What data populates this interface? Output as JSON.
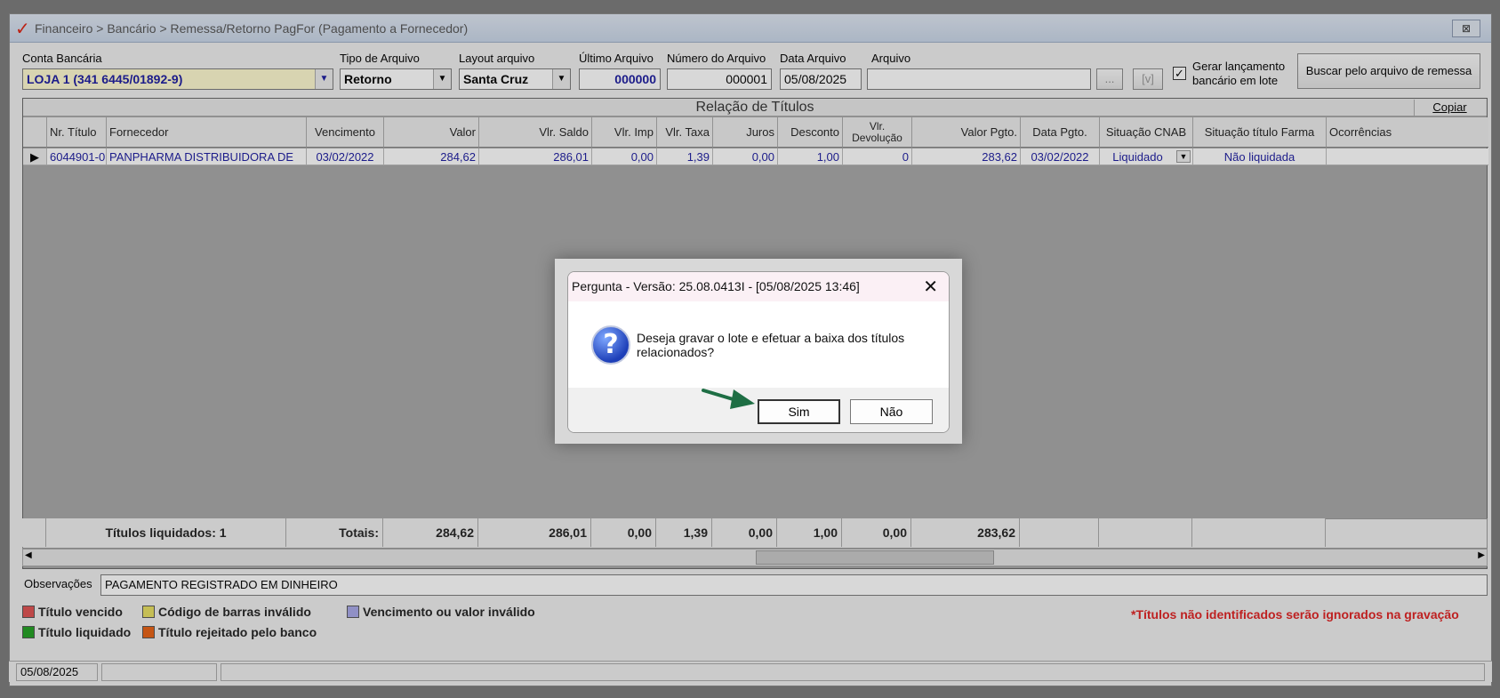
{
  "window": {
    "title": "Financeiro > Bancário > Remessa/Retorno PagFor (Pagamento  a Fornecedor)",
    "close_glyph": "⊠"
  },
  "form": {
    "conta_label": "Conta Bancária",
    "conta_value": "LOJA 1 (341 6445/01892-9)",
    "tipo_label": "Tipo de Arquivo",
    "tipo_value": "Retorno",
    "layout_label": "Layout arquivo",
    "layout_value": "Santa Cruz",
    "ultimo_label": "Último Arquivo",
    "ultimo_value": "000000",
    "numero_label": "Número do Arquivo",
    "numero_value": "000001",
    "data_label": "Data Arquivo",
    "data_value": "05/08/2025",
    "arquivo_label": "Arquivo",
    "arquivo_value": "",
    "browse_label": "...",
    "view_label": "[v]",
    "gerar_label_1": "Gerar lançamento",
    "gerar_label_2": "bancário em lote",
    "buscar_label": "Buscar pelo arquivo de remessa"
  },
  "grid": {
    "caption": "Relação de Títulos",
    "copy_label": "Copiar",
    "columns": [
      "Nr. Título",
      "Fornecedor",
      "Vencimento",
      "Valor",
      "Vlr. Saldo",
      "Vlr. Imp",
      "Vlr. Taxa",
      "Juros",
      "Desconto",
      "Vlr. Devolução",
      "Valor Pgto.",
      "Data Pgto.",
      "Situação CNAB",
      "Situação título Farma",
      "Ocorrências"
    ],
    "row": [
      "6044901-0",
      "PANPHARMA DISTRIBUIDORA DE",
      "03/02/2022",
      "284,62",
      "286,01",
      "0,00",
      "1,39",
      "0,00",
      "1,00",
      "0",
      "283,62",
      "03/02/2022",
      "Liquidado",
      "Não liquidada",
      ""
    ],
    "totals": {
      "liquidados": "Títulos liquidados: 1",
      "totais": "Totais:",
      "valor": "284,62",
      "saldo": "286,01",
      "imp": "0,00",
      "taxa": "1,39",
      "juros": "0,00",
      "desconto": "1,00",
      "devolucao": "0,00",
      "pgto": "283,62"
    }
  },
  "observacoes": {
    "label": "Observações",
    "value": "PAGAMENTO REGISTRADO EM DINHEIRO"
  },
  "legend": {
    "vencido": "Título vencido",
    "codigo": "Código de barras inválido",
    "venc_valor": "Vencimento ou valor inválido",
    "liquidado": "Título liquidado",
    "rejeitado": "Título rejeitado pelo banco",
    "warning": "*Títulos não identificados serão ignorados na gravação",
    "colors": {
      "vencido": "#e05050",
      "codigo": "#e8e060",
      "venc_valor": "#a8a8e8",
      "liquidado": "#20a020",
      "rejeitado": "#e86010",
      "warning": "#e02020"
    }
  },
  "statusbar": {
    "date": "05/08/2025"
  },
  "dialog": {
    "title": "Pergunta - Versão: 25.08.0413I - [05/08/2025 13:46]",
    "close_glyph": "✕",
    "message": "Deseja gravar o lote e efetuar a baixa dos títulos relacionados?",
    "icon": "question-icon",
    "icon_glyph": "?",
    "yes_label": "Sim",
    "no_label": "Não"
  }
}
